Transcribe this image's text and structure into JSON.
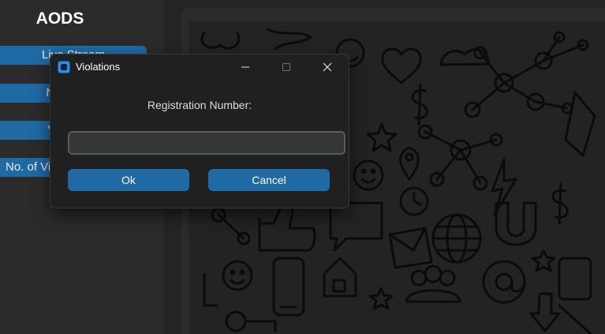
{
  "app": {
    "title": "AODS"
  },
  "sidebar": {
    "items": [
      {
        "label": "Live Stream"
      },
      {
        "label": "New Entry"
      },
      {
        "label": "Violations"
      },
      {
        "label": "No. of Violations"
      }
    ]
  },
  "dialog": {
    "title": "Violations",
    "prompt": "Registration Number:",
    "input_value": "",
    "ok_label": "Ok",
    "cancel_label": "Cancel"
  },
  "colors": {
    "accent": "#1f6aa5",
    "background": "#242424",
    "sidebar": "#2b2b2b",
    "dialog": "#202020"
  }
}
